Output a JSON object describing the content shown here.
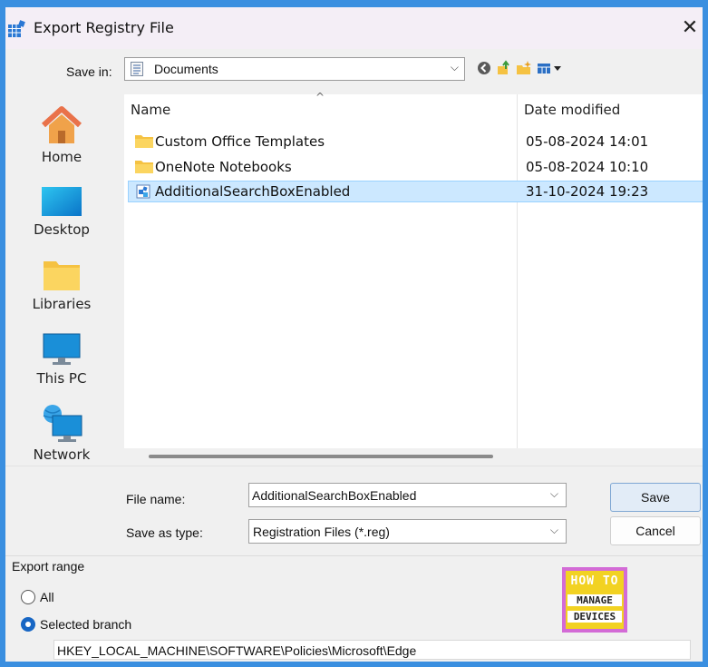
{
  "window": {
    "title": "Export Registry File",
    "close_glyph": "✕"
  },
  "toolbar": {
    "save_in_label": "Save in:",
    "save_in_value": "Documents",
    "dropdown_glyph": "⌵",
    "icons": [
      "back-icon",
      "up-folder-icon",
      "new-folder-icon",
      "view-menu-icon"
    ]
  },
  "places": [
    {
      "label": "Home",
      "icon": "home-icon"
    },
    {
      "label": "Desktop",
      "icon": "desktop-icon"
    },
    {
      "label": "Libraries",
      "icon": "libraries-icon"
    },
    {
      "label": "This PC",
      "icon": "this-pc-icon"
    },
    {
      "label": "Network",
      "icon": "network-icon"
    }
  ],
  "file_list": {
    "columns": [
      "Name",
      "Date modified"
    ],
    "sort_glyph": "^",
    "rows": [
      {
        "name": "Custom Office Templates",
        "date": "05-08-2024 14:01",
        "type": "folder",
        "selected": false
      },
      {
        "name": "OneNote Notebooks",
        "date": "05-08-2024 10:10",
        "type": "folder",
        "selected": false
      },
      {
        "name": "AdditionalSearchBoxEnabled",
        "date": "31-10-2024 19:23",
        "type": "registry-file",
        "selected": true
      }
    ]
  },
  "form": {
    "file_name_label": "File name:",
    "file_name_value": "AdditionalSearchBoxEnabled",
    "save_as_type_label": "Save as type:",
    "save_as_type_value": "Registration Files (*.reg)",
    "save_button": "Save",
    "cancel_button": "Cancel"
  },
  "export_range": {
    "title": "Export range",
    "all_label": "All",
    "selected_branch_label": "Selected branch",
    "selected": "selected_branch",
    "branch_value": "HKEY_LOCAL_MACHINE\\SOFTWARE\\Policies\\Microsoft\\Edge"
  },
  "watermark": {
    "line1": "HOW TO",
    "line2": "MANAGE",
    "line3": "DEVICES"
  },
  "colors": {
    "selection_bg": "#cce8ff",
    "accent": "#1766c4",
    "folder": "#f5c242",
    "frame": "#3a8fe0"
  }
}
